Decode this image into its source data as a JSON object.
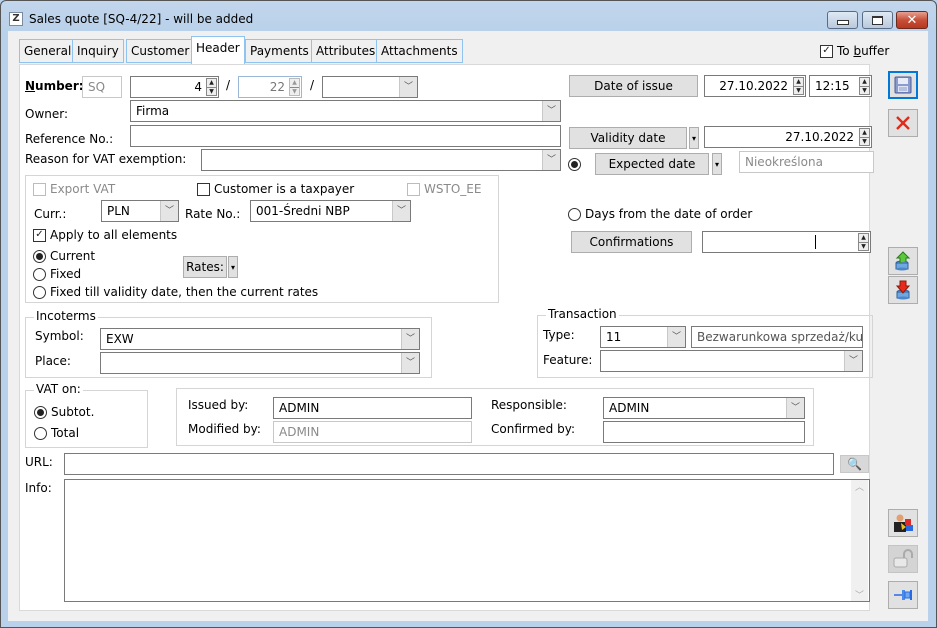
{
  "window": {
    "title": "Sales quote [SQ-4/22] - will be added",
    "app_icon": "Z",
    "controls": {
      "minimize": "minimize-icon",
      "maximize": "maximize-icon",
      "close": "✕"
    }
  },
  "tabs": [
    {
      "label": "General",
      "active": false
    },
    {
      "label": "Inquiry",
      "active": false
    },
    {
      "label": "Customer",
      "active": false
    },
    {
      "label": "Header",
      "active": true
    },
    {
      "label": "Payments",
      "active": false
    },
    {
      "label": "Attributes",
      "active": false
    },
    {
      "label": "Attachments",
      "active": false
    }
  ],
  "to_buffer": {
    "label_prefix": "To ",
    "label_underlined": "b",
    "label_suffix": "uffer",
    "checked": true
  },
  "number": {
    "label_underlined": "N",
    "label_rest": "umber:",
    "prefix": "SQ",
    "seq": "4",
    "year": "22",
    "sep": "/",
    "series": ""
  },
  "owner": {
    "label": "Owner:",
    "value": "Firma"
  },
  "reference": {
    "label": "Reference No.:",
    "value": ""
  },
  "vat_exemption": {
    "label": "Reason for VAT exemption:",
    "value": ""
  },
  "dates": {
    "issue_button": "Date of issue",
    "issue_date": "27.10.2022",
    "issue_time": "12:15",
    "validity_button": "Validity date",
    "validity_date": "27.10.2022",
    "expected_button": "Expected date",
    "expected_value": "Nieokreślona",
    "expected_selected": true,
    "days_from_order_label": "Days from the date of order",
    "days_from_order_selected": false,
    "confirmations_button": "Confirmations",
    "confirmations_value": ""
  },
  "currency": {
    "export_vat": {
      "label": "Export VAT",
      "checked": false,
      "enabled": false
    },
    "customer_taxpayer": {
      "label": "Customer is a taxpayer",
      "checked": false
    },
    "wsto_ee": {
      "label": "WSTO_EE",
      "checked": false,
      "enabled": false
    },
    "curr_label": "Curr.:",
    "curr_value": "PLN",
    "rate_no_label": "Rate No.:",
    "rate_no_value": "001-Średni NBP",
    "apply_all": {
      "label": "Apply to all elements",
      "checked": true
    },
    "rate_modes": [
      {
        "label": "Current",
        "selected": true
      },
      {
        "label": "Fixed",
        "selected": false
      },
      {
        "label": "Fixed till validity date, then the current rates",
        "selected": false
      }
    ],
    "rates_button": "Rates:"
  },
  "incoterms": {
    "title": "Incoterms",
    "symbol_label": "Symbol:",
    "symbol_value": "EXW",
    "place_label": "Place:",
    "place_value": ""
  },
  "transaction": {
    "title": "Transaction",
    "type_label": "Type:",
    "type_value": "11",
    "type_description": "Bezwarunkowa sprzedaż/kup",
    "feature_label": "Feature:",
    "feature_value": ""
  },
  "vat_on": {
    "title": "VAT on:",
    "options": [
      {
        "label": "Subtot.",
        "selected": true
      },
      {
        "label": "Total",
        "selected": false
      }
    ]
  },
  "people": {
    "issued_by_label": "Issued by:",
    "issued_by_value": "ADMIN",
    "modified_by_label": "Modified by:",
    "modified_by_value": "ADMIN",
    "responsible_label": "Responsible:",
    "responsible_value": "ADMIN",
    "confirmed_by_label": "Confirmed by:",
    "confirmed_by_value": ""
  },
  "url": {
    "label": "URL:",
    "value": ""
  },
  "info": {
    "label": "Info:",
    "value": ""
  },
  "side_toolbar": [
    {
      "name": "save-icon"
    },
    {
      "name": "cancel-icon"
    },
    {
      "name": "export-icon"
    },
    {
      "name": "import-icon"
    },
    {
      "name": "user-permissions-icon"
    },
    {
      "name": "unlock-icon"
    },
    {
      "name": "pin-icon"
    }
  ]
}
